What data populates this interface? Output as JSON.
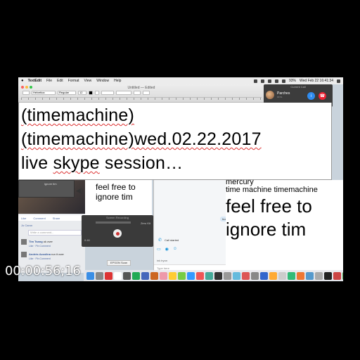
{
  "menubar": {
    "app": "TextEdit",
    "items": [
      "File",
      "Edit",
      "Format",
      "View",
      "Window",
      "Help"
    ],
    "clock": "Wed Feb 22  16:41:34",
    "battery": "93%"
  },
  "textedit": {
    "title": "Untitled — Edited",
    "font_family": "Helvetica",
    "font_style": "Regular",
    "font_size": "12"
  },
  "call": {
    "header": "Current Call",
    "caller": "Parches",
    "status": "00:51"
  },
  "document": {
    "line1": "(timemachine)",
    "line2a": "(timemachine)",
    "line2b": "wed.02.22.2017",
    "line3a": "live ",
    "line3b": "skype",
    "line3c": " session…"
  },
  "facebook": {
    "like": "Like",
    "comment": "Comment",
    "share": "Share",
    "reacted_by": "Jo Caron",
    "placeholder": "Write a comment...",
    "comments": [
      {
        "name": "Tim Tsang",
        "text": "ok over",
        "meta": "Like · Pin Comment"
      },
      {
        "name": "Andrés Azzolina",
        "text": "run it over",
        "meta": "Like · Pin Comment"
      }
    ]
  },
  "mini": {
    "video_label": "ignore tim",
    "text1": "feel free to",
    "text2": "ignore tim"
  },
  "recorder": {
    "title": "Screen Recording",
    "zoom": "Zero Kit",
    "time": "0:46"
  },
  "epson": {
    "label": "EPSON Scan"
  },
  "skype": {
    "msg1": "hurry up dude",
    "msg2": "its 4:20",
    "call_started": "Call started",
    "sender": "ink tryon",
    "type_here": "Type here"
  },
  "right": {
    "word_top": "mercury",
    "line_small": "time machine timemachine",
    "big1": "feel free to",
    "big2": "ignore tim"
  },
  "dock_colors": [
    "#3a8ee6",
    "#888",
    "#d33",
    "#fff",
    "#555",
    "#2a5",
    "#46b",
    "#c62",
    "#e9a",
    "#fc3",
    "#7c4",
    "#39f",
    "#e55",
    "#4a9",
    "#333",
    "#999",
    "#6bd",
    "#d55",
    "#888",
    "#36c",
    "#fa3",
    "#ccc",
    "#3b7",
    "#e73",
    "#59c",
    "#aaa",
    "#222",
    "#c44",
    "#5a5",
    "#bbb"
  ],
  "timecode": "00:00:56;16"
}
